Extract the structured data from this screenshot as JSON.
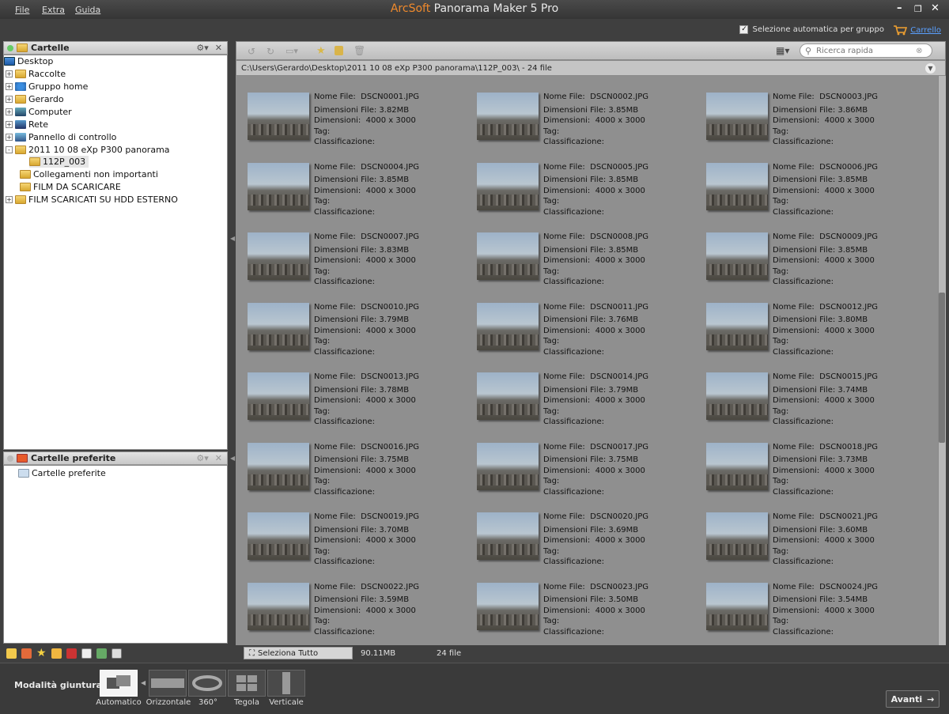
{
  "menu": [
    "File",
    "Extra",
    "Guida"
  ],
  "title": {
    "brand": "ArcSoft",
    "rest": " Panorama Maker 5 Pro"
  },
  "topbar": {
    "auto_select": "Selezione automatica per gruppo",
    "auto_select_checked": true,
    "cart": "Carrello"
  },
  "folders_panel": {
    "title": "Cartelle",
    "nodes": [
      {
        "label": "Desktop",
        "expander": ""
      },
      {
        "label": "Raccolte",
        "expander": "+"
      },
      {
        "label": "Gruppo home",
        "expander": "+"
      },
      {
        "label": "Gerardo",
        "expander": "+"
      },
      {
        "label": "Computer",
        "expander": "+"
      },
      {
        "label": "Rete",
        "expander": "+"
      },
      {
        "label": "Pannello di controllo",
        "expander": "+"
      },
      {
        "label": "2011 10 08 eXp P300 panorama",
        "expander": "-"
      },
      {
        "label": "112P_003",
        "expander": ""
      },
      {
        "label": "Collegamenti non importanti",
        "expander": ""
      },
      {
        "label": "FILM DA SCARICARE",
        "expander": ""
      },
      {
        "label": "FILM SCARICATI SU HDD ESTERNO",
        "expander": "+"
      }
    ]
  },
  "favorites_panel": {
    "title": "Cartelle preferite",
    "nodes": [
      {
        "label": "Cartelle preferite"
      }
    ]
  },
  "search": {
    "placeholder": "Ricerca rapida"
  },
  "path": "C:\\Users\\Gerardo\\Desktop\\2011 10 08 eXp P300 panorama\\112P_003\\ - 24 file",
  "labels": {
    "name": "Nome File:",
    "size": "Dimensioni File:",
    "dims": "Dimensioni:",
    "tag": "Tag:",
    "rating": "Classificazione:"
  },
  "files": [
    {
      "name": "DSCN0001.JPG",
      "size": "3.82MB",
      "dims": "4000 x 3000"
    },
    {
      "name": "DSCN0002.JPG",
      "size": "3.85MB",
      "dims": "4000 x 3000"
    },
    {
      "name": "DSCN0003.JPG",
      "size": "3.86MB",
      "dims": "4000 x 3000"
    },
    {
      "name": "DSCN0004.JPG",
      "size": "3.85MB",
      "dims": "4000 x 3000"
    },
    {
      "name": "DSCN0005.JPG",
      "size": "3.85MB",
      "dims": "4000 x 3000"
    },
    {
      "name": "DSCN0006.JPG",
      "size": "3.85MB",
      "dims": "4000 x 3000"
    },
    {
      "name": "DSCN0007.JPG",
      "size": "3.83MB",
      "dims": "4000 x 3000"
    },
    {
      "name": "DSCN0008.JPG",
      "size": "3.85MB",
      "dims": "4000 x 3000"
    },
    {
      "name": "DSCN0009.JPG",
      "size": "3.85MB",
      "dims": "4000 x 3000"
    },
    {
      "name": "DSCN0010.JPG",
      "size": "3.79MB",
      "dims": "4000 x 3000"
    },
    {
      "name": "DSCN0011.JPG",
      "size": "3.76MB",
      "dims": "4000 x 3000"
    },
    {
      "name": "DSCN0012.JPG",
      "size": "3.80MB",
      "dims": "4000 x 3000"
    },
    {
      "name": "DSCN0013.JPG",
      "size": "3.78MB",
      "dims": "4000 x 3000"
    },
    {
      "name": "DSCN0014.JPG",
      "size": "3.79MB",
      "dims": "4000 x 3000"
    },
    {
      "name": "DSCN0015.JPG",
      "size": "3.74MB",
      "dims": "4000 x 3000"
    },
    {
      "name": "DSCN0016.JPG",
      "size": "3.75MB",
      "dims": "4000 x 3000"
    },
    {
      "name": "DSCN0017.JPG",
      "size": "3.75MB",
      "dims": "4000 x 3000"
    },
    {
      "name": "DSCN0018.JPG",
      "size": "3.73MB",
      "dims": "4000 x 3000"
    },
    {
      "name": "DSCN0019.JPG",
      "size": "3.70MB",
      "dims": "4000 x 3000"
    },
    {
      "name": "DSCN0020.JPG",
      "size": "3.69MB",
      "dims": "4000 x 3000"
    },
    {
      "name": "DSCN0021.JPG",
      "size": "3.60MB",
      "dims": "4000 x 3000"
    },
    {
      "name": "DSCN0022.JPG",
      "size": "3.59MB",
      "dims": "4000 x 3000"
    },
    {
      "name": "DSCN0023.JPG",
      "size": "3.50MB",
      "dims": "4000 x 3000"
    },
    {
      "name": "DSCN0024.JPG",
      "size": "3.54MB",
      "dims": "4000 x 3000"
    }
  ],
  "status": {
    "select_all": "Seleziona Tutto",
    "total_size": "90.11MB",
    "count": "24 file"
  },
  "mode_bar": {
    "label": "Modalità giuntura:",
    "modes": [
      {
        "label": "Automatico",
        "selected": true
      },
      {
        "label": "Orizzontale",
        "selected": false
      },
      {
        "label": "360°",
        "selected": false
      },
      {
        "label": "Tegola",
        "selected": false
      },
      {
        "label": "Verticale",
        "selected": false
      }
    ],
    "next": "Avanti"
  },
  "colors": {
    "accent": "#f08a2c",
    "link": "#5aa0ff",
    "background": "#3f3f3f",
    "grid": "#8f8f8f"
  }
}
